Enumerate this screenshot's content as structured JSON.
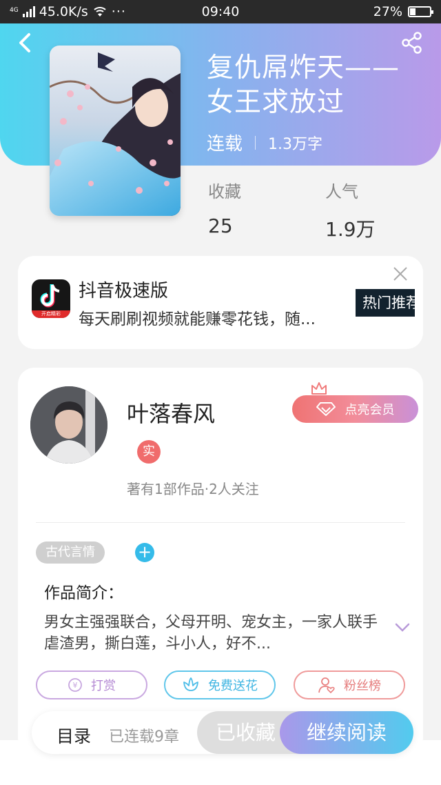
{
  "status_bar": {
    "network": "4G",
    "speed": "45.0K/s",
    "dots": "···",
    "time": "09:40",
    "battery": "27%"
  },
  "header": {
    "back_icon": "chevron-left-icon",
    "share_icon": "share-icon",
    "title": "复仇屌炸天——女王求放过",
    "status": "连载",
    "word_count": "1.3万字",
    "stats": [
      {
        "label": "收藏",
        "value": "25"
      },
      {
        "label": "人气",
        "value": "1.9万"
      }
    ]
  },
  "ad": {
    "icon": "tiktok-icon",
    "icon_strip_text": "开启精彩",
    "title": "抖音极速版",
    "description": "每天刷刷视频就能赚零花钱，随...",
    "tag": "热门推荐",
    "close_icon": "close-icon"
  },
  "author": {
    "name": "叶落春风",
    "badge": "实",
    "stats_text": "著有1部作品·2人关注",
    "member_button": "点亮会员",
    "genre_tag": "古代言情",
    "add_tag": "+",
    "intro_label": "作品简介：",
    "intro_text": "男女主强强联合，父母开明、宠女主，一家人联手虐渣男，撕白莲，斗小人，好不...",
    "actions": [
      {
        "label": "打赏",
        "icon": "coin-icon"
      },
      {
        "label": "免费送花",
        "icon": "flower-icon"
      },
      {
        "label": "粉丝榜",
        "icon": "user-heart-icon"
      }
    ]
  },
  "bottom_bar": {
    "catalog": "目录",
    "chapters": "已连载9章",
    "collected": "已收藏",
    "continue": "继续阅读"
  },
  "colors": {
    "header_gradient_start": "#4fd6ef",
    "header_gradient_end": "#b99ae9",
    "accent_blue": "#35bbe9",
    "accent_red": "#f06c6c"
  }
}
